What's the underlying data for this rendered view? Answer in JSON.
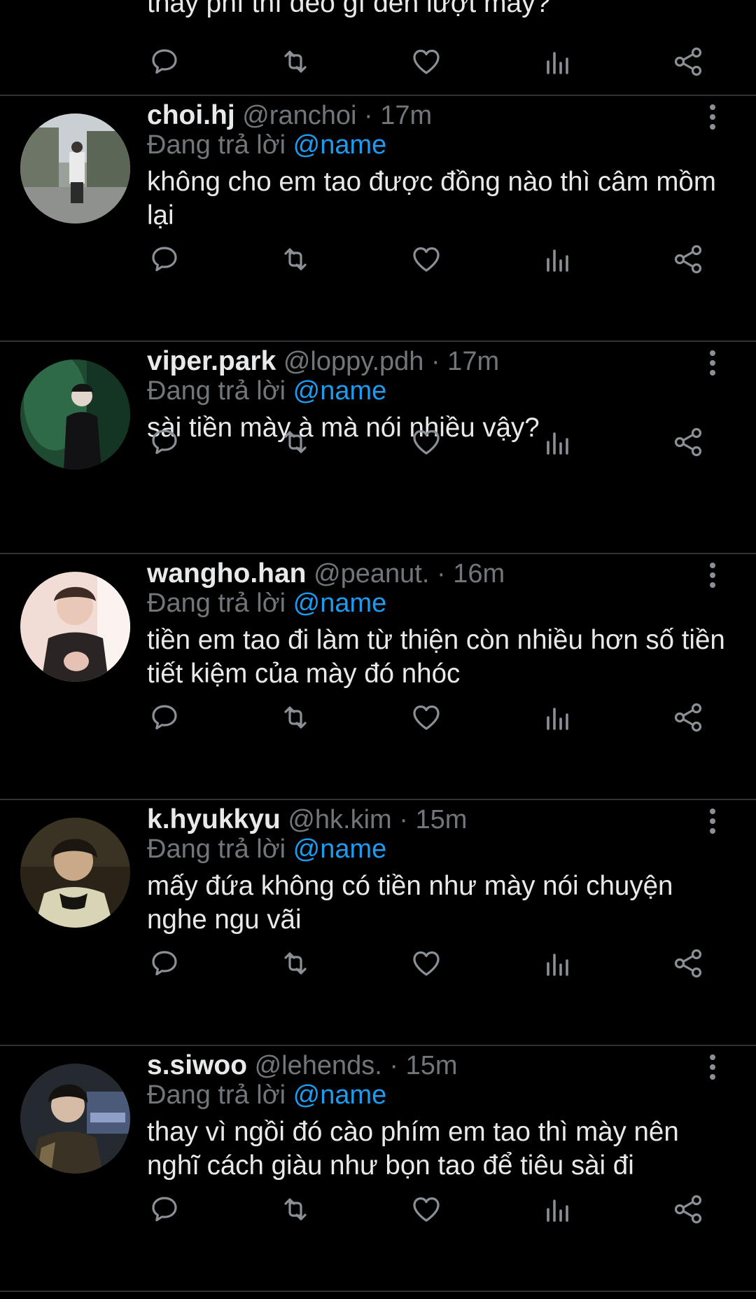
{
  "top_partial": {
    "text": "thay phí thì đéo gì đến lượt mày?"
  },
  "replying_prefix": "Đang trả lời",
  "replies": [
    {
      "display_name": "choi.hj",
      "handle": "@ranchoi",
      "time": "· 17m",
      "replying_to": "@name",
      "text": "không cho em tao được đồng nào thì câm mồm lại"
    },
    {
      "display_name": "viper.park",
      "handle": "@loppy.pdh",
      "time": "· 17m",
      "replying_to": "@name",
      "text": "sài tiền mày à mà nói nhiều vậy?"
    },
    {
      "display_name": "wangho.han",
      "handle": "@peanut.",
      "time": "· 16m",
      "replying_to": "@name",
      "text": "tiền em tao đi làm từ thiện còn nhiều hơn số tiền tiết kiệm của mày đó nhóc"
    },
    {
      "display_name": "k.hyukkyu",
      "handle": "@hk.kim",
      "time": "· 15m",
      "replying_to": "@name",
      "text": "mấy đứa không có tiền như mày nói chuyện nghe ngu vãi"
    },
    {
      "display_name": "s.siwoo",
      "handle": "@lehends.",
      "time": "· 15m",
      "replying_to": "@name",
      "text": "thay vì ngồi đó cào phím em tao thì mày nên nghĩ cách giàu như bọn tao để tiêu sài đi"
    }
  ],
  "action_icons": [
    "reply-icon",
    "retweet-icon",
    "like-icon",
    "views-icon",
    "share-icon"
  ],
  "colors": {
    "background": "#000000",
    "text": "#e7e9ea",
    "muted": "#71767b",
    "mention": "#1d9bf0",
    "divider": "#2f3336"
  }
}
